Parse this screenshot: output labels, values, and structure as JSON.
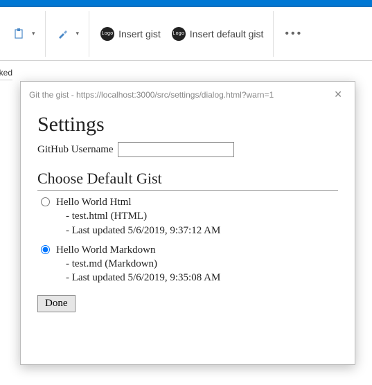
{
  "ribbon": {
    "insert_gist_label": "Insert gist",
    "insert_default_gist_label": "Insert default gist",
    "logo_text": "Logo",
    "more_label": "More options"
  },
  "partial_text": "ked",
  "dialog": {
    "title": "Git the gist - https://localhost:3000/src/settings/dialog.html?warn=1",
    "heading": "Settings",
    "username_label": "GitHub Username",
    "username_value": "",
    "choose_heading": "Choose Default Gist",
    "done_label": "Done",
    "gists": [
      {
        "title": "Hello World Html",
        "file_line": "- test.html (HTML)",
        "updated_line": "- Last updated 5/6/2019, 9:37:12 AM",
        "selected": false
      },
      {
        "title": "Hello World Markdown",
        "file_line": "- test.md (Markdown)",
        "updated_line": "- Last updated 5/6/2019, 9:35:08 AM",
        "selected": true
      }
    ]
  }
}
